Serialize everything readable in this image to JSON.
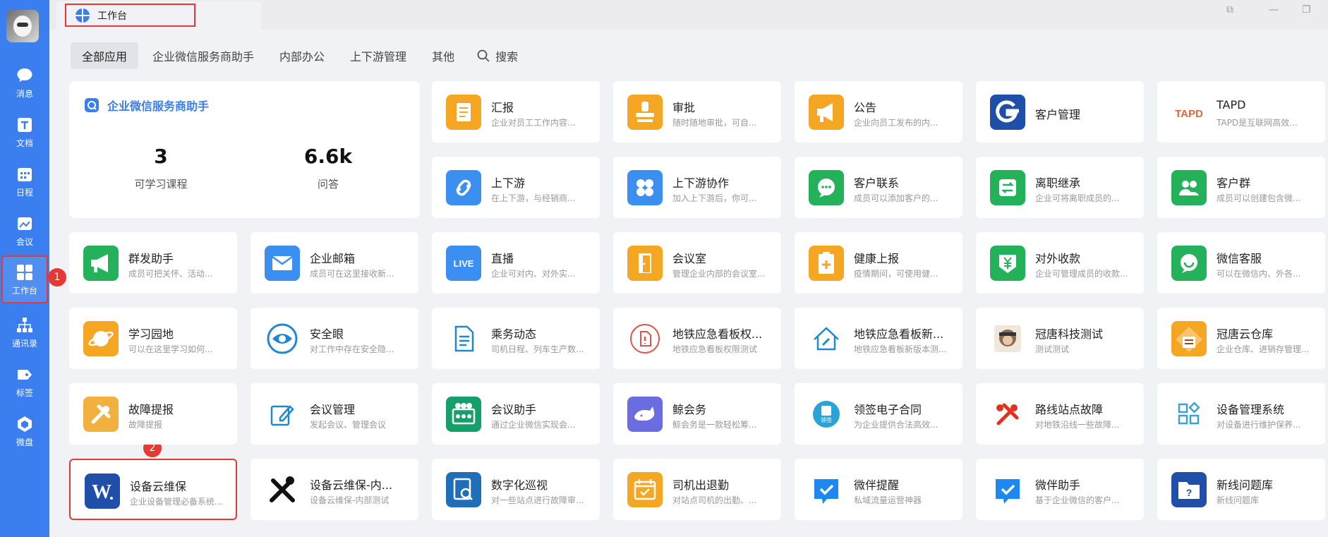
{
  "sidebar": {
    "items": [
      {
        "label": "消息",
        "icon": "message-icon"
      },
      {
        "label": "文档",
        "icon": "document-icon"
      },
      {
        "label": "日程",
        "icon": "calendar-icon"
      },
      {
        "label": "会议",
        "icon": "meeting-icon"
      },
      {
        "label": "工作台",
        "icon": "workbench-icon"
      },
      {
        "label": "通讯录",
        "icon": "contacts-icon"
      },
      {
        "label": "标签",
        "icon": "tag-icon"
      },
      {
        "label": "微盘",
        "icon": "drive-icon"
      }
    ]
  },
  "markers": [
    "1",
    "2"
  ],
  "tab": {
    "label": "工作台",
    "icon": "workbench-globe-icon"
  },
  "categories": [
    "全部应用",
    "企业微信服务商助手",
    "内部办公",
    "上下游管理",
    "其他"
  ],
  "search_label": "搜索",
  "promo": {
    "title": "企业微信服务商助手",
    "stats": [
      {
        "value": "3",
        "label": "可学习课程"
      },
      {
        "value": "6.6k",
        "label": "问答"
      }
    ]
  },
  "apps": [
    {
      "name": "汇报",
      "desc": "企业对员工工作内容...",
      "color": "#f5a623",
      "icon": "report-icon"
    },
    {
      "name": "审批",
      "desc": "随时随地审批，可自...",
      "color": "#f5a623",
      "icon": "stamp-icon"
    },
    {
      "name": "公告",
      "desc": "企业向员工发布的内...",
      "color": "#f5a623",
      "icon": "megaphone-icon"
    },
    {
      "name": "客户管理",
      "desc": "",
      "color": "#1f4fa8",
      "icon": "g-logo-icon"
    },
    {
      "name": "TAPD",
      "desc": "TAPD是互联网高效...",
      "color": "#ffffff",
      "icon": "tapd-logo-icon"
    },
    {
      "name": "上下游",
      "desc": "在上下游，与经销商...",
      "color": "#3b8ff0",
      "icon": "link-icon"
    },
    {
      "name": "上下游协作",
      "desc": "加入上下游后，你可...",
      "color": "#3b8ff0",
      "icon": "grid-dots-icon"
    },
    {
      "name": "客户联系",
      "desc": "成员可以添加客户的...",
      "color": "#23b15a",
      "icon": "chat-bubble-icon"
    },
    {
      "name": "离职继承",
      "desc": "企业可将离职成员的...",
      "color": "#23b15a",
      "icon": "transfer-icon"
    },
    {
      "name": "客户群",
      "desc": "成员可以创建包含微...",
      "color": "#23b15a",
      "icon": "group-icon"
    },
    {
      "name": "群发助手",
      "desc": "成员可把关怀、活动...",
      "color": "#23b15a",
      "icon": "broadcast-icon"
    },
    {
      "name": "企业邮箱",
      "desc": "成员可在这里接收新...",
      "color": "#3b8ff0",
      "icon": "mail-icon"
    },
    {
      "name": "直播",
      "desc": "企业可对内、对外实...",
      "color": "#3b8ff0",
      "icon": "live-icon",
      "badge": "LIVE"
    },
    {
      "name": "会议室",
      "desc": "管理企业内部的会议室...",
      "color": "#f5a623",
      "icon": "door-icon"
    },
    {
      "name": "健康上报",
      "desc": "疫情期间，可使用健...",
      "color": "#f5a623",
      "icon": "health-clipboard-icon"
    },
    {
      "name": "对外收款",
      "desc": "企业可管理成员的收款...",
      "color": "#23b15a",
      "icon": "yuan-icon"
    },
    {
      "name": "微信客服",
      "desc": "可以在微信内、外各...",
      "color": "#23b15a",
      "icon": "service-chat-icon"
    },
    {
      "name": "学习园地",
      "desc": "可以在这里学习如何...",
      "color": "#f5a623",
      "icon": "planet-icon"
    },
    {
      "name": "安全眼",
      "desc": "对工作中存在安全隐...",
      "color": "#ffffff",
      "icon": "eye-icon"
    },
    {
      "name": "乘务动态",
      "desc": "司机日程、列车生产数...",
      "color": "#ffffff",
      "icon": "file-lines-icon"
    },
    {
      "name": "地铁应急看板权...",
      "desc": "地铁应急看板权限测试",
      "color": "#ffffff",
      "icon": "red-file-icon"
    },
    {
      "name": "地铁应急看板新...",
      "desc": "地铁应急看板新版本测...",
      "color": "#ffffff",
      "icon": "house-wrench-icon"
    },
    {
      "name": "冠唐科技测试",
      "desc": "测试测试",
      "color": "#ffffff",
      "icon": "monkey-icon"
    },
    {
      "name": "冠唐云仓库",
      "desc": "企业仓库、进销存管理...",
      "color": "#f5a623",
      "icon": "warehouse-icon"
    },
    {
      "name": "故障提报",
      "desc": "故障提报",
      "color": "#f2b03e",
      "icon": "tools-icon"
    },
    {
      "name": "会议管理",
      "desc": "发起会议、管理会议",
      "color": "#ffffff",
      "icon": "edit-doc-icon"
    },
    {
      "name": "会议助手",
      "desc": "通过企业微信实现会...",
      "color": "#15a06a",
      "icon": "meeting-people-icon"
    },
    {
      "name": "鲸会务",
      "desc": "鲸会务是一款轻松筹...",
      "color": "#6a6ce0",
      "icon": "whale-icon"
    },
    {
      "name": "领签电子合同",
      "desc": "为企业提供合法高效...",
      "color": "#ffffff",
      "icon": "seal-icon"
    },
    {
      "name": "路线站点故障",
      "desc": "对地铁沿线一些故障...",
      "color": "#ffffff",
      "icon": "red-tools-icon"
    },
    {
      "name": "设备管理系统",
      "desc": "对设备进行维护保养...",
      "color": "#ffffff",
      "icon": "squares-diamond-icon"
    },
    {
      "name": "设备云维保",
      "desc": "企业设备管理必备系统...",
      "color": "#1f4fa8",
      "icon": "word-w-icon"
    },
    {
      "name": "设备云维保-内...",
      "desc": "设备云维保-内部测试",
      "color": "#ffffff",
      "icon": "cross-tools-icon"
    },
    {
      "name": "数字化巡视",
      "desc": "对一些站点进行故障审...",
      "color": "#1f6fb8",
      "icon": "inspect-doc-icon"
    },
    {
      "name": "司机出退勤",
      "desc": "对站点司机的出勤、...",
      "color": "#f5a623",
      "icon": "calendar-check-icon"
    },
    {
      "name": "微伴提醒",
      "desc": "私域流量运营神器",
      "color": "#ffffff",
      "icon": "blue-check-icon"
    },
    {
      "name": "微伴助手",
      "desc": "基于企业微信的客户...",
      "color": "#ffffff",
      "icon": "blue-check-icon"
    },
    {
      "name": "新线问题库",
      "desc": "新线问题库",
      "color": "#1f4fa8",
      "icon": "question-folder-icon"
    }
  ]
}
